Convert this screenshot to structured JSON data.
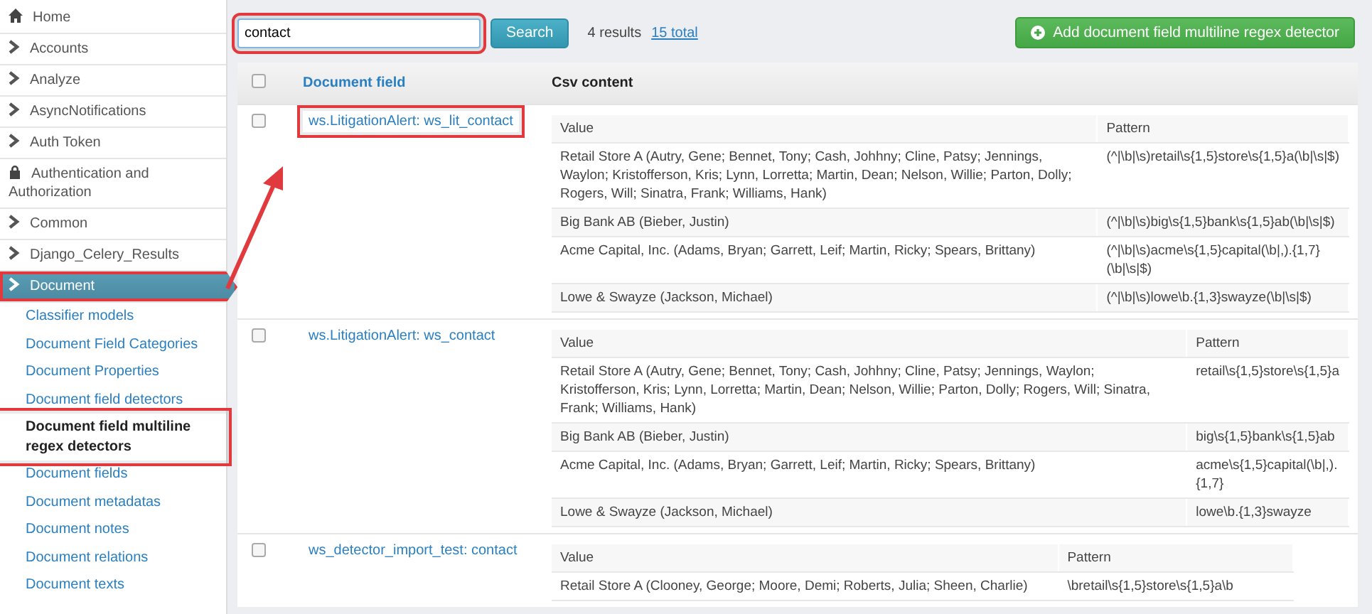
{
  "sidebar": {
    "items": [
      {
        "label": "Home",
        "kind": "home",
        "selected": false
      },
      {
        "label": "Accounts",
        "kind": "chevron",
        "selected": false
      },
      {
        "label": "Analyze",
        "kind": "chevron",
        "selected": false
      },
      {
        "label": "AsyncNotifications",
        "kind": "chevron",
        "selected": false
      },
      {
        "label": "Auth Token",
        "kind": "chevron",
        "selected": false
      },
      {
        "label": "Authentication and Authorization",
        "kind": "lock",
        "selected": false
      },
      {
        "label": "Common",
        "kind": "chevron",
        "selected": false
      },
      {
        "label": "Django_Celery_Results",
        "kind": "chevron",
        "selected": false
      },
      {
        "label": "Document",
        "kind": "chevron",
        "selected": true,
        "highlighted": true
      }
    ],
    "subitems": [
      {
        "label": "Classifier models",
        "selected": false
      },
      {
        "label": "Document Field Categories",
        "selected": false
      },
      {
        "label": "Document Properties",
        "selected": false
      },
      {
        "label": "Document field detectors",
        "selected": false
      },
      {
        "label": "Document field multiline regex detectors",
        "selected": true,
        "highlighted": true
      },
      {
        "label": "Document fields",
        "selected": false
      },
      {
        "label": "Document metadatas",
        "selected": false
      },
      {
        "label": "Document notes",
        "selected": false
      },
      {
        "label": "Document relations",
        "selected": false
      },
      {
        "label": "Document texts",
        "selected": false
      }
    ]
  },
  "search": {
    "value": "contact",
    "highlighted": true,
    "button": "Search",
    "results": "4 results",
    "total": "15 total"
  },
  "add_button": "Add document field multiline regex detector",
  "table": {
    "columns": [
      "Document field",
      "Csv content"
    ],
    "header_checked": false,
    "rows": [
      {
        "checked": false,
        "field": "ws.LitigationAlert: ws_lit_contact",
        "highlighted": true,
        "csv": {
          "columns": [
            "Value",
            "Pattern"
          ],
          "rows": [
            [
              "Retail Store A (Autry, Gene; Bennet, Tony; Cash, Johhny; Cline, Patsy; Jennings, Waylon; Kristofferson, Kris; Lynn, Lorretta; Martin, Dean; Nelson, Willie; Parton, Dolly; Rogers, Will; Sinatra, Frank; Williams, Hank)",
              "(^|\\b|\\s)retail\\s{1,5}store\\s{1,5}a(\\b|\\s|$)"
            ],
            [
              "Big Bank AB (Bieber, Justin)",
              "(^|\\b|\\s)big\\s{1,5}bank\\s{1,5}ab(\\b|\\s|$)"
            ],
            [
              "Acme Capital, Inc. (Adams, Bryan; Garrett, Leif; Martin, Ricky; Spears, Brittany)",
              "(^|\\b|\\s)acme\\s{1,5}capital(\\b|,).{1,7}(\\b|\\s|$)"
            ],
            [
              "Lowe & Swayze (Jackson, Michael)",
              "(^|\\b|\\s)lowe\\b.{1,3}swayze(\\b|\\s|$)"
            ]
          ]
        }
      },
      {
        "checked": false,
        "field": "ws.LitigationAlert: ws_contact",
        "highlighted": false,
        "csv": {
          "columns": [
            "Value",
            "Pattern"
          ],
          "rows": [
            [
              "Retail Store A (Autry, Gene; Bennet, Tony; Cash, Johhny; Cline, Patsy; Jennings, Waylon; Kristofferson, Kris; Lynn, Lorretta; Martin, Dean; Nelson, Willie; Parton, Dolly; Rogers, Will; Sinatra, Frank; Williams, Hank)",
              "retail\\s{1,5}store\\s{1,5}a"
            ],
            [
              "Big Bank AB (Bieber, Justin)",
              "big\\s{1,5}bank\\s{1,5}ab"
            ],
            [
              "Acme Capital, Inc. (Adams, Bryan; Garrett, Leif; Martin, Ricky; Spears, Brittany)",
              "acme\\s{1,5}capital(\\b|,).{1,7}"
            ],
            [
              "Lowe & Swayze (Jackson, Michael)",
              "lowe\\b.{1,3}swayze"
            ]
          ]
        }
      },
      {
        "checked": false,
        "field": "ws_detector_import_test: contact",
        "highlighted": false,
        "csv": {
          "columns": [
            "Value",
            "Pattern"
          ],
          "rows": [
            [
              "Retail Store A (Clooney, George; Moore, Demi; Roberts, Julia; Sheen, Charlie)",
              "\\bretail\\s{1,5}store\\s{1,5}a\\b"
            ]
          ]
        }
      }
    ]
  }
}
